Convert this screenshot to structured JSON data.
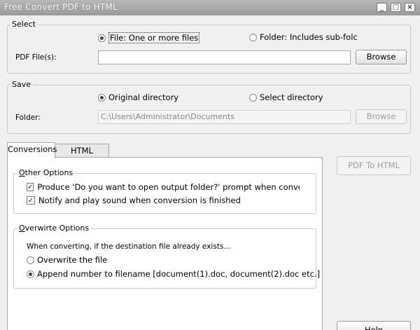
{
  "window": {
    "title": "Free Convert PDF to HTML"
  },
  "title_buttons": {
    "minimize": "_",
    "maximize": "□",
    "close": "×"
  },
  "select_group": {
    "legend": "Select",
    "radio_file": "File:  One or more files",
    "radio_folder": "Folder: Includes sub-folc",
    "pdf_label": "PDF File(s):",
    "pdf_value": "",
    "browse": "Browse"
  },
  "save_group": {
    "legend": "Save",
    "radio_original": "Original directory",
    "radio_select": "Select directory",
    "folder_label": "Folder:",
    "folder_value": "C:\\Users\\Administrator\\Documents",
    "browse": "Browse"
  },
  "tabs": [
    {
      "label": "Conversions",
      "active": true
    },
    {
      "label": "HTML Options",
      "active": false
    }
  ],
  "other_options": {
    "legend": "Other Options",
    "check_prompt": "Produce 'Do you want to open output folder?' prompt when conversion is finis",
    "check_sound": "Notify and play sound when conversion is finished"
  },
  "overwrite_options": {
    "legend": "Overwirte Options",
    "description": "When converting, if the destination file already exists...",
    "radio_overwrite": "Overwrite the file",
    "radio_append": "Append number to filename  [document(1).doc, document(2).doc etc.]"
  },
  "actions": {
    "convert": "PDF To HTML",
    "help": "Help"
  },
  "glyphs": {
    "check": "✓"
  }
}
